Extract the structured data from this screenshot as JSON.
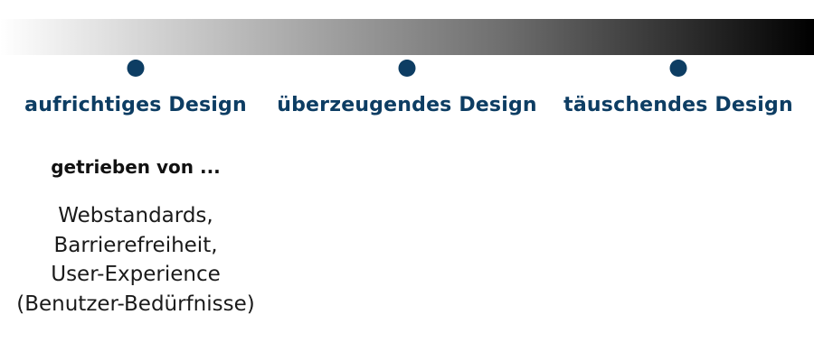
{
  "colors": {
    "accent": "#0d3d63",
    "text": "#1a1a1a"
  },
  "categories": [
    {
      "label": "aufrichtiges Design"
    },
    {
      "label": "überzeugendes Design"
    },
    {
      "label": "täuschendes Design"
    }
  ],
  "driven_by": {
    "heading": "getrieben von ...",
    "items": [
      "Webstandards,",
      "Barrierefreiheit,",
      "User-Experience",
      "(Benutzer-Bedürfnisse)"
    ]
  }
}
